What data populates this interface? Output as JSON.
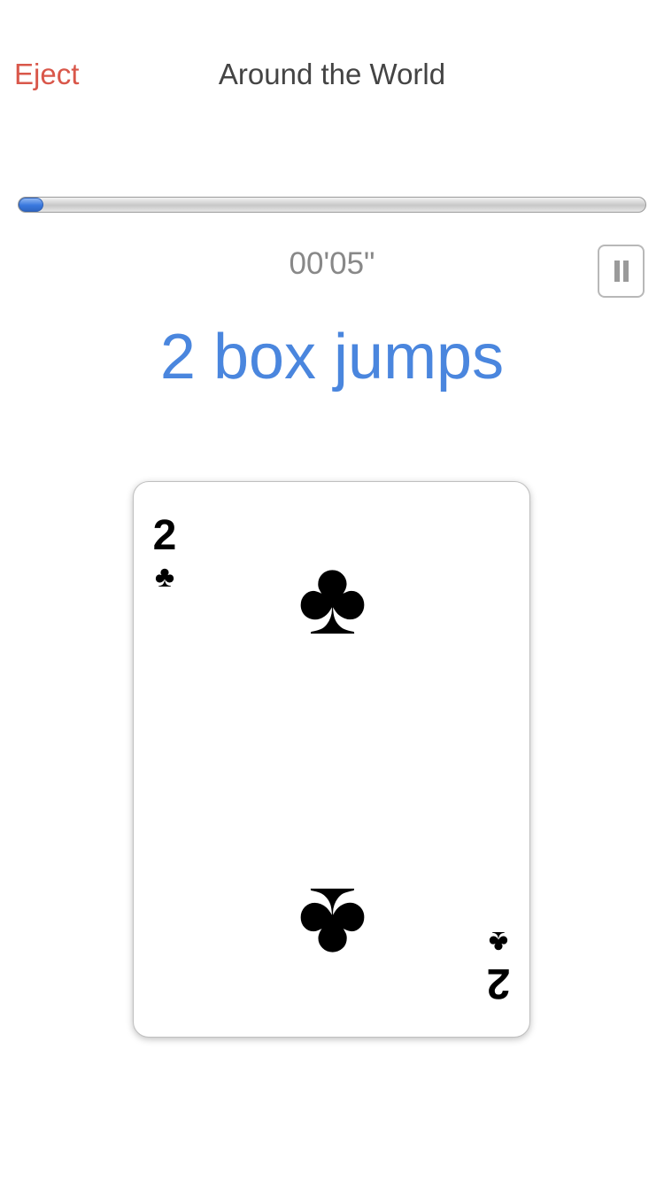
{
  "nav": {
    "eject_label": "Eject",
    "title": "Around the World"
  },
  "progress": {
    "fraction": 0.037,
    "accent_color": "#3a78de"
  },
  "timer": {
    "elapsed": "00'05\""
  },
  "pause_button": {
    "icon": "pause-icon"
  },
  "exercise": {
    "text": "2 box jumps",
    "color": "#4a86de"
  },
  "card": {
    "rank": "2",
    "suit_symbol": "♣",
    "suit_name": "clubs"
  },
  "colors": {
    "eject": "#d9574a",
    "title": "#444444",
    "timer": "#888888"
  }
}
